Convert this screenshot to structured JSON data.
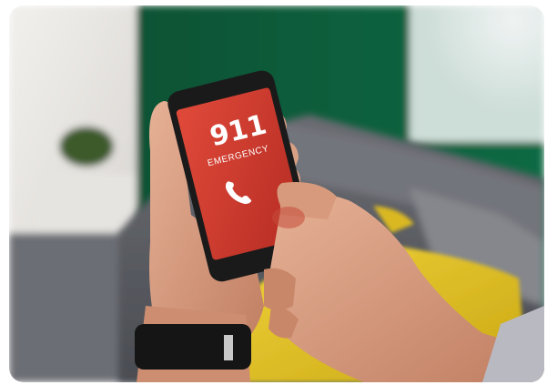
{
  "photo": {
    "subject": "hand-holding-smartphone-emergency-call",
    "phone_screen": {
      "number": "911",
      "label": "EMERGENCY",
      "icon": "phone-handset-icon",
      "screen_color": "#d13a2e"
    },
    "colors": {
      "wall_green": "#0d5a3a",
      "wall_light": "#e8e6e3",
      "sofa_gray": "#5f6168",
      "pillow_yellow": "#e2c21c",
      "skin": "#d79a7c",
      "phone_body": "#1a1a1a",
      "watch_band": "#151515"
    }
  }
}
